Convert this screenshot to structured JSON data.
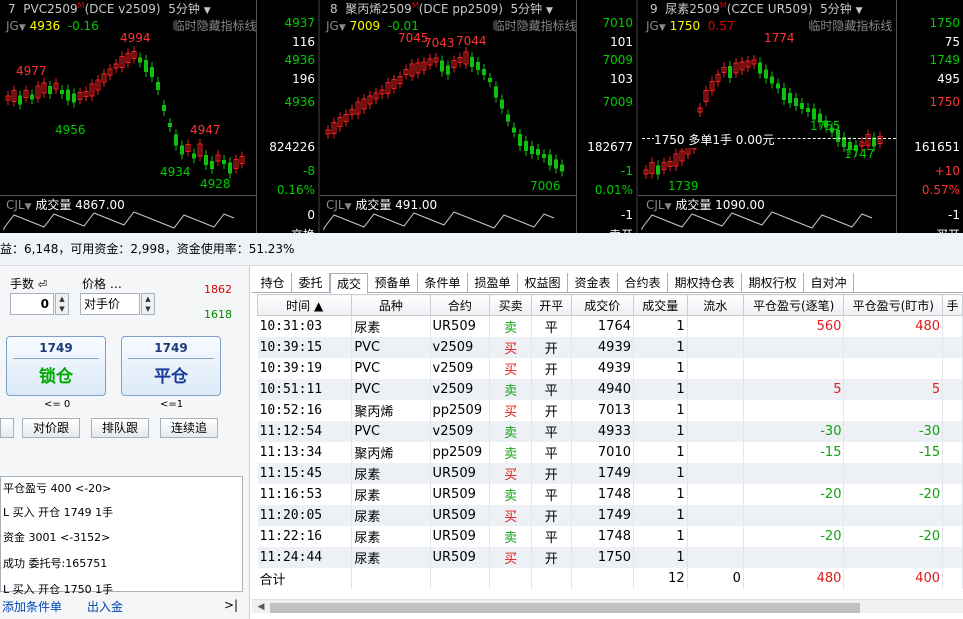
{
  "charts": [
    {
      "idx": "7",
      "name": "PVC2509",
      "m": "M",
      "contract": "(DCE v2509)",
      "period": "5分钟",
      "indicator_tag": "临时隐藏指标线",
      "jg_label": "JG",
      "price": "4936",
      "change": "-0.16",
      "axis_labels": [
        "4937",
        "116",
        "4936",
        "196",
        "4936",
        "824226",
        "-8",
        "0.16%",
        "0",
        "交换"
      ],
      "annotations": [
        "4994",
        "4977",
        "4956",
        "4947",
        "4934",
        "4928"
      ],
      "vol_label": "CJL",
      "vol_text": "成交量 4867.00"
    },
    {
      "idx": "8",
      "name": "聚丙烯2509",
      "m": "M",
      "contract": "(DCE pp2509)",
      "period": "5分钟",
      "indicator_tag": "临时隐藏指标线",
      "jg_label": "JG",
      "price": "7009",
      "change": "-0.01",
      "axis_labels": [
        "7010",
        "101",
        "7009",
        "103",
        "7009",
        "182677",
        "-1",
        "0.01%",
        "-1",
        "卖开"
      ],
      "annotations": [
        "7045",
        "7043",
        "7044",
        "7006"
      ],
      "vol_label": "CJL",
      "vol_text": "成交量 491.00"
    },
    {
      "idx": "9",
      "name": "尿素2509",
      "m": "M",
      "contract": "(CZCE UR509)",
      "period": "5分钟",
      "indicator_tag": "临时隐藏指标线",
      "jg_label": "JG",
      "price": "1750",
      "change": "0.57",
      "axis_labels": [
        "1750",
        "75",
        "1749",
        "495",
        "1750",
        "161651",
        "+10",
        "0.57%",
        "-1",
        "买开"
      ],
      "annotations": [
        "1774",
        "1755",
        "1747",
        "1739"
      ],
      "position_line": "1750 多单1手 0.00元",
      "vol_label": "CJL",
      "vol_text": "成交量 1090.00"
    }
  ],
  "status_bar": "益：6,148，可用资金：2,998，资金使用率：51.23%",
  "order": {
    "qty_label": "手数",
    "qty_value": "0",
    "price_label": "价格 …",
    "price_value": "对手价",
    "upper": "1862",
    "lower": "1618",
    "lock": {
      "price": "1749",
      "label": "锁仓",
      "note": "<= 0"
    },
    "close": {
      "price": "1749",
      "label": "平仓",
      "note": "<=1"
    },
    "buttons": [
      "",
      "对价跟",
      "排队跟",
      "连续追"
    ]
  },
  "log": [
    "平仓盈亏 400  <-20>",
    "L  买入  开仓  1749  1手",
    "资金 3001  <-3152>",
    "成功  委托号:165751",
    "L  买入  开仓  1750  1手"
  ],
  "bottom_links": {
    "add_condition": "添加条件单",
    "deposit": "出入金",
    "collapse": ">|"
  },
  "tabs": [
    "持仓",
    "委托",
    "成交",
    "预备单",
    "条件单",
    "损盈单",
    "权益图",
    "资金表",
    "合约表",
    "期权持仓表",
    "期权行权",
    "自对冲"
  ],
  "active_tab": "成交",
  "table": {
    "headers": [
      "时间 ▲",
      "品种",
      "合约",
      "买卖",
      "开平",
      "成交价",
      "成交量",
      "流水",
      "平仓盈亏(逐笔)",
      "平仓盈亏(盯市)",
      "手"
    ],
    "rows": [
      [
        "10:31:03",
        "尿素",
        "UR509",
        "卖",
        "平",
        "1764",
        "1",
        "",
        "560",
        "480"
      ],
      [
        "10:39:15",
        "PVC",
        "v2509",
        "买",
        "开",
        "4939",
        "1",
        "",
        "",
        ""
      ],
      [
        "10:39:19",
        "PVC",
        "v2509",
        "买",
        "开",
        "4939",
        "1",
        "",
        "",
        ""
      ],
      [
        "10:51:11",
        "PVC",
        "v2509",
        "卖",
        "平",
        "4940",
        "1",
        "",
        "5",
        "5"
      ],
      [
        "10:52:16",
        "聚丙烯",
        "pp2509",
        "买",
        "开",
        "7013",
        "1",
        "",
        "",
        ""
      ],
      [
        "11:12:54",
        "PVC",
        "v2509",
        "卖",
        "平",
        "4933",
        "1",
        "",
        "-30",
        "-30"
      ],
      [
        "11:13:34",
        "聚丙烯",
        "pp2509",
        "卖",
        "平",
        "7010",
        "1",
        "",
        "-15",
        "-15"
      ],
      [
        "11:15:45",
        "尿素",
        "UR509",
        "买",
        "开",
        "1749",
        "1",
        "",
        "",
        ""
      ],
      [
        "11:16:53",
        "尿素",
        "UR509",
        "卖",
        "平",
        "1748",
        "1",
        "",
        "-20",
        "-20"
      ],
      [
        "11:20:05",
        "尿素",
        "UR509",
        "买",
        "开",
        "1749",
        "1",
        "",
        "",
        ""
      ],
      [
        "11:22:16",
        "尿素",
        "UR509",
        "卖",
        "平",
        "1748",
        "1",
        "",
        "-20",
        "-20"
      ],
      [
        "11:24:44",
        "尿素",
        "UR509",
        "买",
        "开",
        "1750",
        "1",
        "",
        "",
        ""
      ]
    ],
    "total": [
      "合计",
      "",
      "",
      "",
      "",
      "",
      "12",
      "0",
      "480",
      "400"
    ]
  },
  "colors": {
    "up": "#e01a1a",
    "down": "#10b010",
    "buy": "#e01a1a",
    "sell": "#1aa01a"
  }
}
